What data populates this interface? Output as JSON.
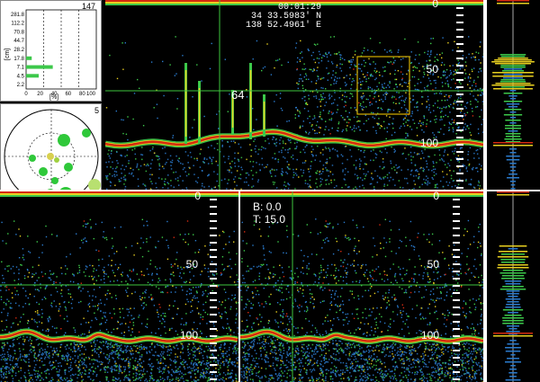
{
  "hud": {
    "time": "00:01:29",
    "lat": "34 33.5983' N",
    "lon": "138 52.4961' E",
    "marker_depth": "64"
  },
  "panes": {
    "top": {
      "depth_labels": [
        "0",
        "50",
        "100"
      ]
    },
    "bottom_left": {
      "depth_labels": [
        "0",
        "50",
        "100"
      ]
    },
    "bottom_right": {
      "depth_labels": [
        "0",
        "50",
        "100"
      ]
    },
    "bottom_right_info": {
      "b_label": "B:",
      "b_value": "0.0",
      "t_label": "T:",
      "t_value": "15.0"
    }
  },
  "histogram_inset": {
    "count": "147",
    "unit_y": "[cm]",
    "unit_x": "[%]",
    "y_labels": [
      "281.8",
      "112.2",
      "70.8",
      "44.7",
      "28.2",
      "17.8",
      "7.1",
      "4.5",
      "2.2"
    ],
    "x_labels": [
      "0",
      "20",
      "40",
      "60",
      "80",
      "100"
    ]
  },
  "target_inset": {
    "count": "5"
  },
  "colors": {
    "background": "#000000",
    "echo_red": "#d42a10",
    "echo_yellow": "#e8d020",
    "echo_green": "#3cc84a",
    "echo_blue": "#2a7acc",
    "crosshair": "#3ec63e",
    "selection_box": "#d4b000"
  },
  "chart_data": {
    "type": "bar",
    "categories": [
      "281.8",
      "112.2",
      "70.8",
      "44.7",
      "28.2",
      "17.8",
      "7.1",
      "4.5",
      "2.2"
    ],
    "values": [
      0,
      0,
      0,
      0,
      0,
      8,
      38,
      18,
      0
    ],
    "xlabel": "[%]",
    "ylabel": "[cm]",
    "xlim": [
      0,
      100
    ]
  }
}
